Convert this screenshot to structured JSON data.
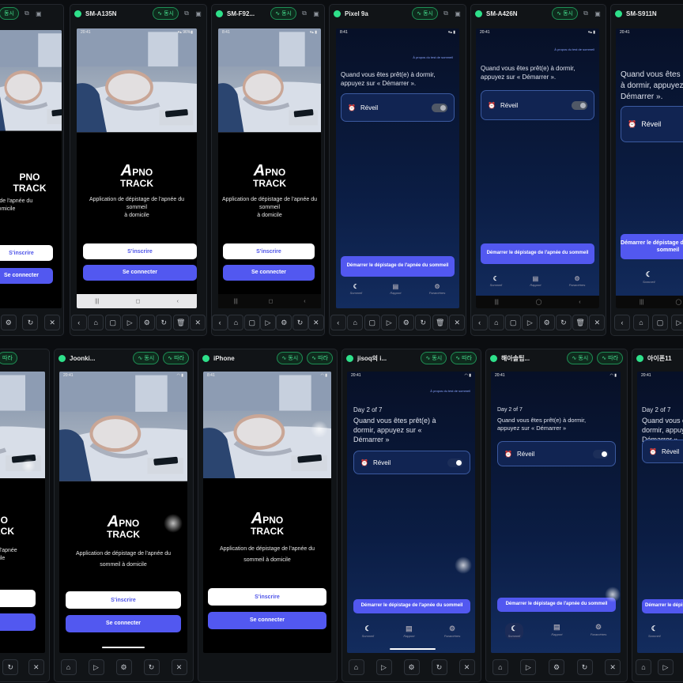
{
  "labels": {
    "sync": "동시",
    "mirror": "따라",
    "title_line1": "Application de dépistage de l'apnée du sommeil",
    "title_line2": "à domicile",
    "subtitle_full": "Application de dépistage de l'apnée du sommeil à domicile",
    "signup": "S'inscrire",
    "login": "Se connecter",
    "prompt_short": "Quand vous êtes prêt(e) à dormir, appuyez sur « Démarrer ».",
    "prompt_long": "Quand vous êtes prêt(e) à dormir, appuyez sur « Démarrer »",
    "alarm": "Réveil",
    "start": "Démarrer le dépistage de l'apnée du sommeil",
    "day": "Day 2 of 7",
    "tab_sleep": "Sommeil",
    "tab_report": "Rapport",
    "tab_settings": "Paramètres",
    "logo_a": "A",
    "logo_b": "PNO",
    "logo_c": "TRACK",
    "link_top": "À propos du test de sommeil"
  },
  "devices": [
    {
      "name": "SM-A135N"
    },
    {
      "name": "SM-F92..."
    },
    {
      "name": "Pixel 9a"
    },
    {
      "name": "SM-A426N"
    },
    {
      "name": "SM-S911N"
    },
    {
      "name": "Joonki..."
    },
    {
      "name": "iPhone"
    },
    {
      "name": "jisoq의 i..."
    },
    {
      "name": "해아솔팁..."
    },
    {
      "name": "아이폰11"
    }
  ],
  "status": {
    "time_android": "20:41",
    "time_ios": "8:41",
    "time_2": "20:41",
    "time_pixel": "8:41"
  },
  "colors": {
    "accent": "#5258f0",
    "sync_green": "#2ee08a",
    "dark_bg": "#0b1d44"
  },
  "alarm_states": {
    "pixel": false,
    "sm_a426n": false,
    "jisoq": true,
    "haesol": true
  }
}
